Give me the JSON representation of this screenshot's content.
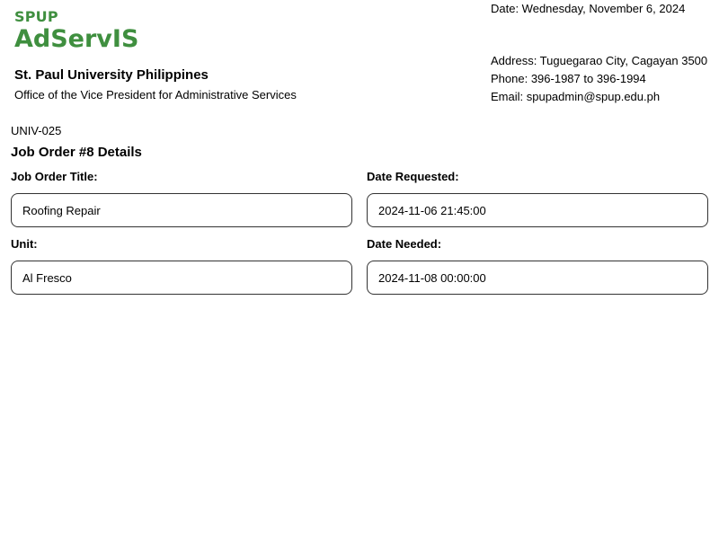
{
  "header": {
    "brand_small": "SPUP",
    "brand_large": "AdServIS",
    "university": "St. Paul University Philippines",
    "office": "Office of the Vice President for Administrative Services",
    "date_line": "Date: Wednesday, November 6, 2024",
    "address": "Address: Tuguegarao City, Cagayan 3500",
    "phone": "Phone: 396-1987 to 396-1994",
    "email": "Email: spupadmin@spup.edu.ph",
    "brand_color": "#3f8f3f"
  },
  "job_order": {
    "code": "UNIV-025",
    "heading": "Job Order #8 Details",
    "fields": [
      {
        "label": "Job Order Title:",
        "value": "Roofing Repair"
      },
      {
        "label": "Date Requested:",
        "value": "2024-11-06 21:45:00"
      },
      {
        "label": "Unit:",
        "value": "Al Fresco"
      },
      {
        "label": "Date Needed:",
        "value": "2024-11-08 00:00:00"
      }
    ]
  }
}
